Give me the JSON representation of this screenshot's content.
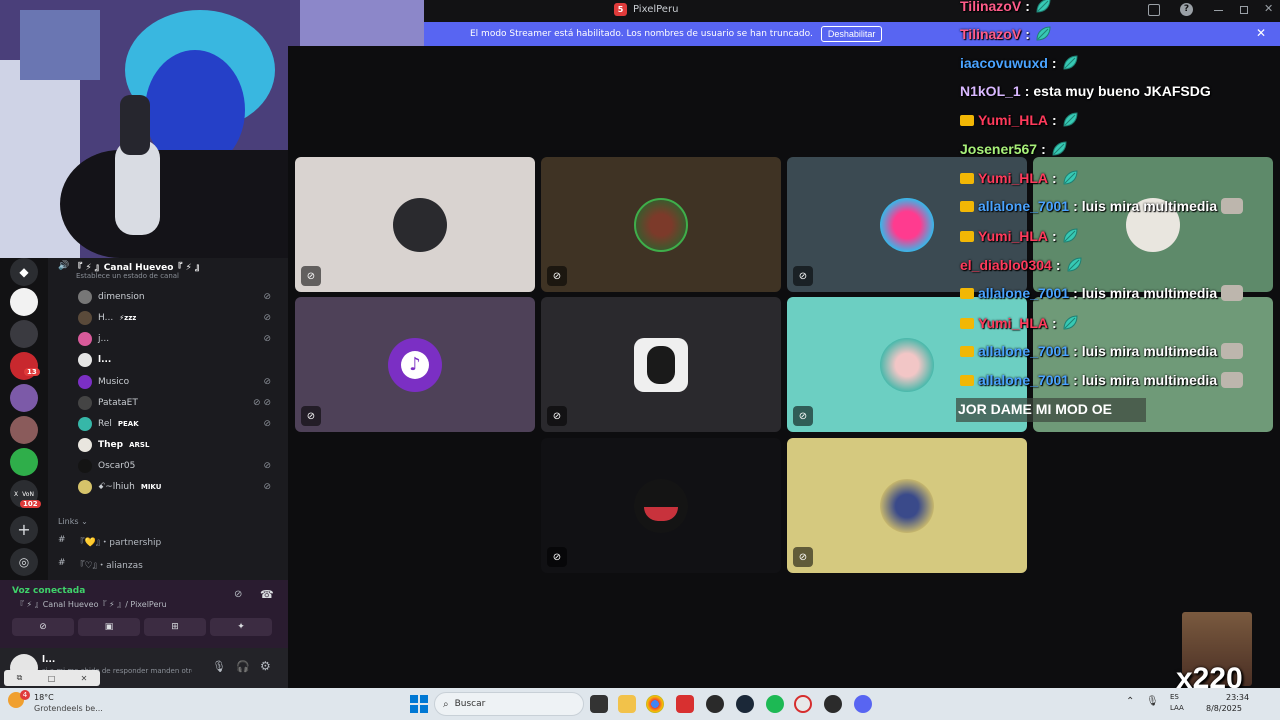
{
  "window": {
    "title": "PixelPeru",
    "logo_letter": "5"
  },
  "streamer_bar": {
    "message": "El modo Streamer está habilitado. Los nombres de usuario se han truncado.",
    "button": "Deshabilitar",
    "close": "✕"
  },
  "channel": {
    "name": "『 ⚡ 』Canal Hueveo『 ⚡ 』",
    "status_prompt": "Establece un estado de canal",
    "members": [
      {
        "name": "dimension",
        "tag": ""
      },
      {
        "name": "H...",
        "tag": "⚡zzz"
      },
      {
        "name": "j...",
        "tag": ""
      },
      {
        "name": "l...",
        "tag": ""
      },
      {
        "name": "Musico",
        "tag": ""
      },
      {
        "name": "PatataET",
        "tag": ""
      },
      {
        "name": "Rel",
        "tag": "PEAK"
      },
      {
        "name": "Thep",
        "tag": "ARSL"
      },
      {
        "name": "Oscar05",
        "tag": ""
      },
      {
        "name": "ꗃ~lhiuh",
        "tag": "MIKU"
      }
    ],
    "category": "Links",
    "text_channels": [
      {
        "name": "『💛』・partnership"
      },
      {
        "name": "『♡』・alianzas"
      }
    ]
  },
  "servers": {
    "badges": [
      "13",
      "102"
    ],
    "label_x": "X",
    "label_von": "VoN"
  },
  "voice": {
    "status": "Voz conectada",
    "location": "『 ⚡ 』Canal Hueveo『 ⚡ 』/ PixelPeru"
  },
  "user": {
    "name": "l...",
    "status": "si a mi me chido de responder manden otro ..."
  },
  "chat": [
    {
      "user": "TilinazoV",
      "color": "#ff5c8a",
      "crown": false,
      "text": "",
      "emote": true
    },
    {
      "user": "TilinazoV",
      "color": "#ff5c8a",
      "crown": false,
      "text": "",
      "emote": true
    },
    {
      "user": "iaacovuwuxd",
      "color": "#4aa3ff",
      "crown": false,
      "text": "",
      "emote": true
    },
    {
      "user": "N1kOL_1",
      "color": "#d9b8ff",
      "crown": false,
      "text": "esta muy bueno JKAFSDG",
      "emote": false
    },
    {
      "user": "Yumi_HLA",
      "color": "#ff3b5c",
      "crown": true,
      "text": "",
      "emote": true
    },
    {
      "user": "Josener567",
      "color": "#a8f07a",
      "crown": false,
      "text": "",
      "emote": true
    },
    {
      "user": "Yumi_HLA",
      "color": "#ff3b5c",
      "crown": true,
      "text": "",
      "emote": true
    },
    {
      "user": "allalone_7001",
      "color": "#4aa3ff",
      "crown": true,
      "text": "luis mira multimedia",
      "emote": false
    },
    {
      "user": "Yumi_HLA",
      "color": "#ff3b5c",
      "crown": true,
      "text": "",
      "emote": true
    },
    {
      "user": "el_diablo0304",
      "color": "#ff3b5c",
      "crown": false,
      "text": "",
      "emote": true
    },
    {
      "user": "allalone_7001",
      "color": "#4aa3ff",
      "crown": true,
      "text": "luis mira multimedia",
      "emote": false
    },
    {
      "user": "Yumi_HLA",
      "color": "#ff3b5c",
      "crown": true,
      "text": "",
      "emote": true
    },
    {
      "user": "allalone_7001",
      "color": "#4aa3ff",
      "crown": true,
      "text": "luis mira multimedia",
      "emote": false
    },
    {
      "user": "allalone_7001",
      "color": "#4aa3ff",
      "crown": true,
      "text": "luis mira multimedia",
      "emote": false
    }
  ],
  "chat_fragment": "JOR DAME MI MOD OE",
  "overlay_counter": "x220",
  "taskbar": {
    "search_placeholder": "Buscar",
    "weather_temp": "18°C",
    "weather_desc": "Grotendeels be...",
    "lang_top": "ES",
    "lang_bottom": "LAA",
    "time": "23:34",
    "date": "8/8/2025",
    "notification_count": "4"
  }
}
